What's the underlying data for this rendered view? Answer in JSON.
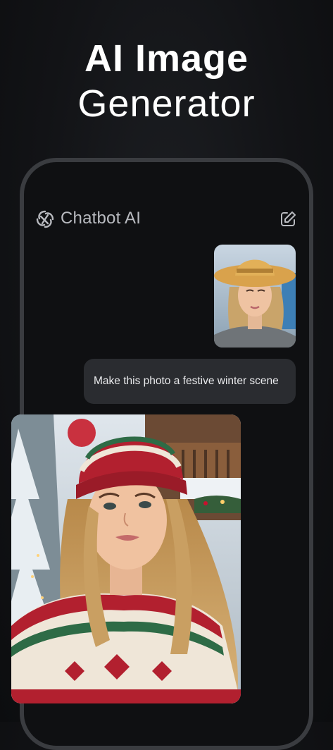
{
  "headline": {
    "line1": "AI Image",
    "line2": "Generator"
  },
  "app": {
    "title": "Chatbot AI",
    "logo_icon": "chatbot-logo-icon",
    "edit_icon": "edit-icon"
  },
  "chat": {
    "user_photo": "woman in straw hat",
    "user_message": "Make this photo a festive winter scene",
    "result_photo": "woman in knit beanie and festive sweater in snowy scene"
  },
  "colors": {
    "background": "#121316",
    "phone_frame": "#3a3c40",
    "bubble": "#2a2c30",
    "title_text": "#b8babf"
  }
}
